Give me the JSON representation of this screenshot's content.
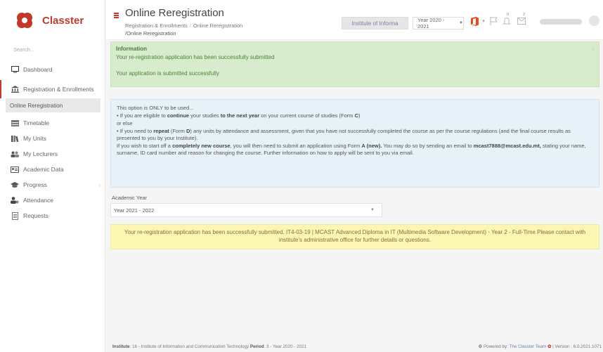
{
  "app": {
    "name": "Classter"
  },
  "sidebar": {
    "search_placeholder": "Search...",
    "items": [
      {
        "label": "Dashboard",
        "icon": "monitor-icon"
      },
      {
        "label": "Registration & Enrollments",
        "icon": "building-icon"
      },
      {
        "label": "Timetable",
        "icon": "table-icon"
      },
      {
        "label": "My Units",
        "icon": "books-icon"
      },
      {
        "label": "My Lecturers",
        "icon": "users-icon"
      },
      {
        "label": "Academic Data",
        "icon": "id-card-icon"
      },
      {
        "label": "Progress",
        "icon": "graduation-cap-icon"
      },
      {
        "label": "Attendance",
        "icon": "user-clock-icon"
      },
      {
        "label": "Requests",
        "icon": "document-icon"
      }
    ],
    "sub_item": "Online Reregistration"
  },
  "header": {
    "title": "Online Reregistration",
    "breadcrumb": [
      "Registration & Enrollments",
      "Online Reregistration"
    ],
    "breadcrumb_last": "Online Reregistration",
    "institute_button": "Institute of Informa",
    "year_select": "Year 2020 - 2021",
    "notification_count": "0",
    "message_count": "2"
  },
  "info": {
    "title": "Information",
    "line1": "Your re-registration application has been successfully submitted",
    "line2": "Your application is submitted successfully"
  },
  "notice": {
    "intro": "This option is ONLY to be used...",
    "p1_a": "• If you are eligible to ",
    "p1_b": "continue",
    "p1_c": " your studies ",
    "p1_d": "to the next year",
    "p1_e": " on your current course of studies (Form ",
    "p1_f": "C",
    "p1_g": ")",
    "or_else": "or else",
    "p2_a": "• If you need to ",
    "p2_b": "repeat",
    "p2_c": " (Form ",
    "p2_d": "D",
    "p2_e": ") any units by attendance and assessment, given that you have not successfully completed the course as per the course regulations (and the final course results as presented to you by your Institute).",
    "p3_a": "If you wish to start off a ",
    "p3_b": "completely new course",
    "p3_c": ", you will then need to submit an application using Form ",
    "p3_d": "A (new).",
    "p3_e": " You may do so by sending an email to ",
    "p3_f": "mcast7888@mcast.edu.mt,",
    "p3_g": " stating your name, surname, ID card number and reason for changing the course. Further information on how to apply will be sent to you via email."
  },
  "academic_year": {
    "label": "Academic Year",
    "value": "Year 2021 - 2022"
  },
  "warning": {
    "text": "Your re-registration application has been successfully submitted. IT4-03-19 | MCAST Advanced Diploma in IT (Multimedia Software Development) - Year 2 - Full-Time Please contact with institute's administrative office for further details or questions."
  },
  "footer": {
    "institute_label": "Institute",
    "institute_value": ": 16 - Institute of Information and Communication Technology",
    "period_label": "Period",
    "period_value": ": 3 - Year 2020 - 2021",
    "powered": "Powered by: ",
    "team": "The Classter Team",
    "version": "| Version : 6.0.2021.1071"
  },
  "colors": {
    "brand": "#c0392b",
    "info_bg": "#d7eccd",
    "notice_bg": "#e7f1f8",
    "warning_bg": "#fbf6b1"
  }
}
